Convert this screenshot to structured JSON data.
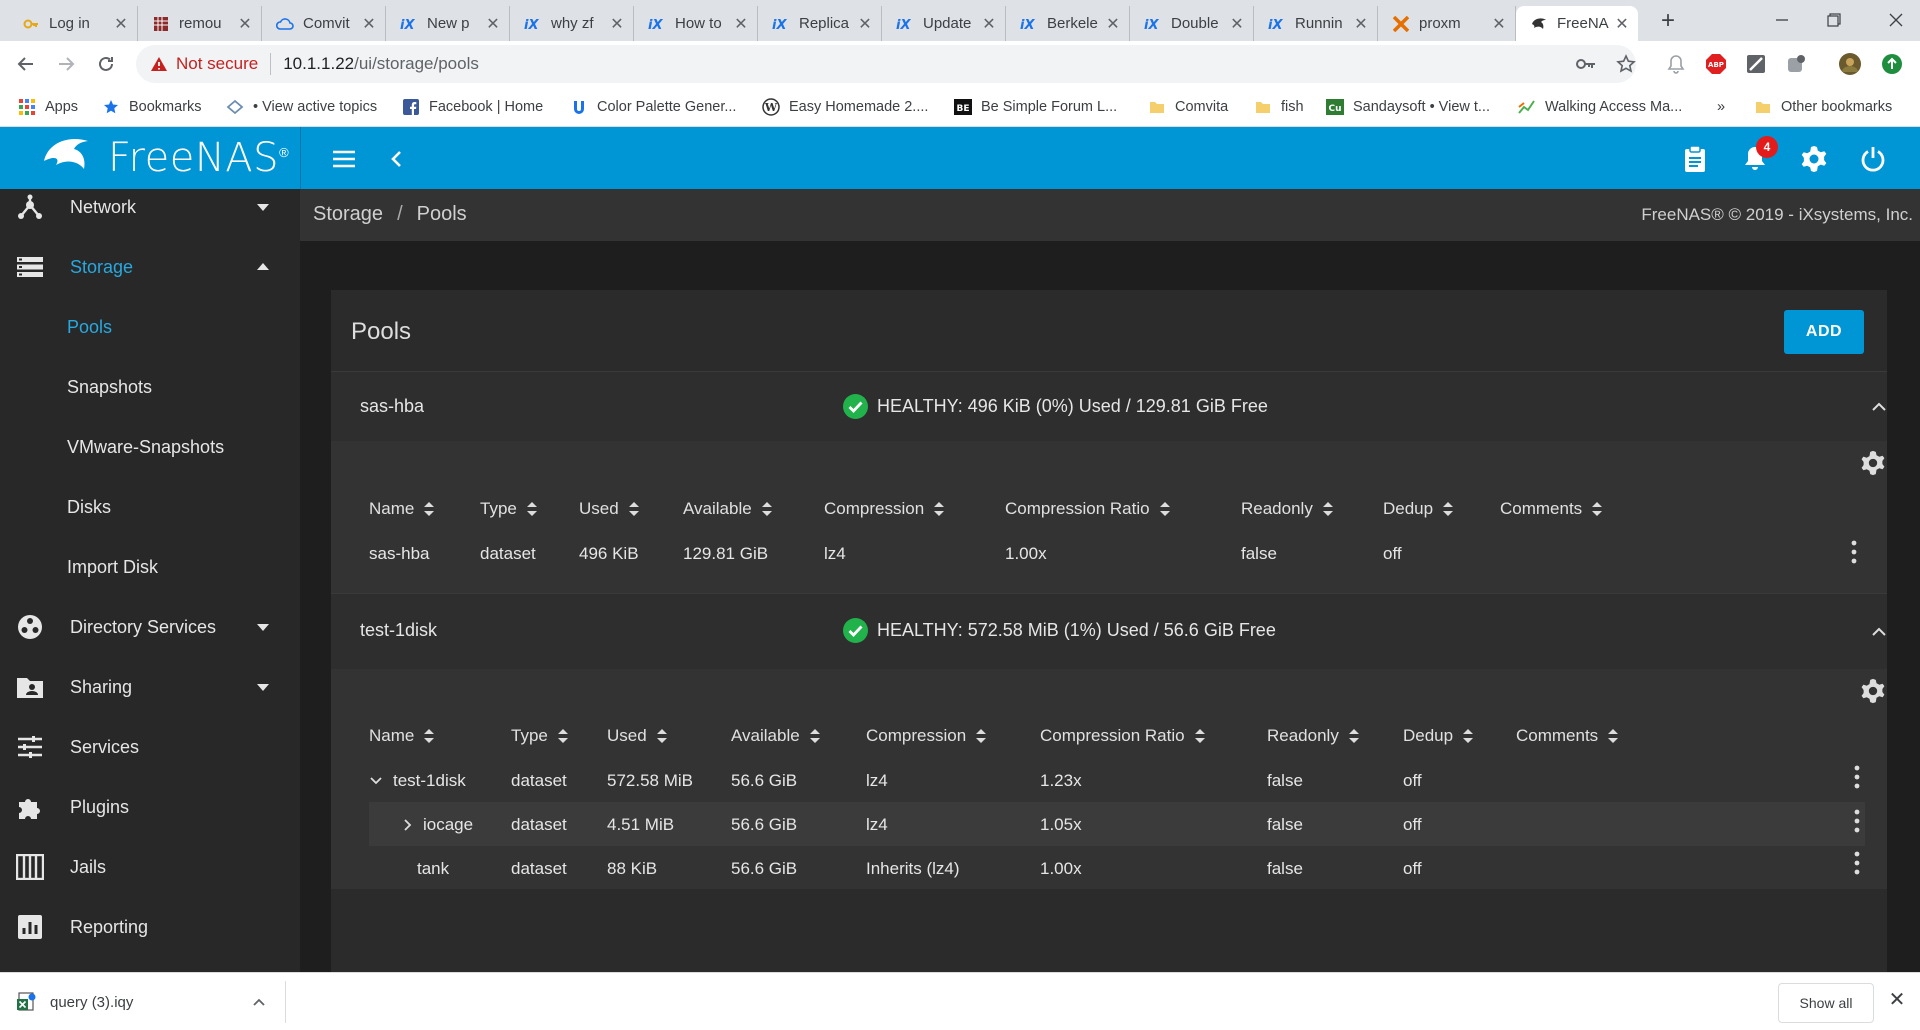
{
  "browser": {
    "tabs": [
      {
        "title": "Log in",
        "icon": "key-icon"
      },
      {
        "title": "remou",
        "icon": "grid-icon"
      },
      {
        "title": "Comvit",
        "icon": "cloud-icon"
      },
      {
        "title": "New p",
        "icon": "freenas-icon"
      },
      {
        "title": "why zf",
        "icon": "freenas-icon"
      },
      {
        "title": "How to",
        "icon": "freenas-icon"
      },
      {
        "title": "Replica",
        "icon": "freenas-icon"
      },
      {
        "title": "Update",
        "icon": "freenas-icon"
      },
      {
        "title": "Berkele",
        "icon": "freenas-icon"
      },
      {
        "title": "Double",
        "icon": "freenas-icon"
      },
      {
        "title": "Runnin",
        "icon": "freenas-icon"
      },
      {
        "title": "proxm",
        "icon": "proxmox-icon"
      },
      {
        "title": "FreeNA",
        "icon": "freenas-logo-icon",
        "active": true
      }
    ],
    "security_label": "Not secure",
    "url_host": "10.1.1.22",
    "url_path": "/ui/storage/pools",
    "bookmarks": [
      {
        "label": "Apps",
        "icon": "apps-grid-icon"
      },
      {
        "label": "Bookmarks",
        "icon": "star-icon"
      },
      {
        "label": "• View active topics",
        "icon": "forum-icon"
      },
      {
        "label": "Facebook | Home",
        "icon": "facebook-icon"
      },
      {
        "label": "Color Palette Gener...",
        "icon": "palette-icon"
      },
      {
        "label": "Easy Homemade 2....",
        "icon": "wordpress-icon"
      },
      {
        "label": "Be Simple Forum L...",
        "icon": "be-icon"
      },
      {
        "label": "Comvita",
        "icon": "folder-icon"
      },
      {
        "label": "fish",
        "icon": "folder-icon"
      },
      {
        "label": "Sandaysoft • View t...",
        "icon": "cu-icon"
      },
      {
        "label": "Walking Access Ma...",
        "icon": "walking-icon"
      }
    ],
    "bookmarks_overflow": "»",
    "other_bookmarks": "Other bookmarks",
    "ext_abp": "ABP"
  },
  "app": {
    "brand": "FreeNAS",
    "brand_tm": "®",
    "notification_count": "4",
    "breadcrumb": [
      "Storage",
      "Pools"
    ],
    "copyright": "FreeNAS® © 2019 - iXsystems, Inc.",
    "sidebar": {
      "network": "Network",
      "storage": "Storage",
      "storage_sub": [
        "Pools",
        "Snapshots",
        "VMware-Snapshots",
        "Disks",
        "Import Disk"
      ],
      "directory_services": "Directory Services",
      "sharing": "Sharing",
      "services": "Services",
      "plugins": "Plugins",
      "jails": "Jails",
      "reporting": "Reporting"
    },
    "card_title": "Pools",
    "add_label": "ADD",
    "columns": [
      "Name",
      "Type",
      "Used",
      "Available",
      "Compression",
      "Compression Ratio",
      "Readonly",
      "Dedup",
      "Comments"
    ],
    "pools": [
      {
        "name": "sas-hba",
        "status": "HEALTHY: 496 KiB (0%) Used / 129.81 GiB Free",
        "rows": [
          {
            "name": "sas-hba",
            "type": "dataset",
            "used": "496 KiB",
            "available": "129.81 GiB",
            "compression": "lz4",
            "ratio": "1.00x",
            "readonly": "false",
            "dedup": "off",
            "comments": ""
          }
        ]
      },
      {
        "name": "test-1disk",
        "status": "HEALTHY: 572.58 MiB (1%) Used / 56.6 GiB Free",
        "rows": [
          {
            "name": "test-1disk",
            "type": "dataset",
            "used": "572.58 MiB",
            "available": "56.6 GiB",
            "compression": "lz4",
            "ratio": "1.23x",
            "readonly": "false",
            "dedup": "off",
            "comments": ""
          },
          {
            "name": "iocage",
            "type": "dataset",
            "used": "4.51 MiB",
            "available": "56.6 GiB",
            "compression": "lz4",
            "ratio": "1.05x",
            "readonly": "false",
            "dedup": "off",
            "comments": ""
          },
          {
            "name": "tank",
            "type": "dataset",
            "used": "88 KiB",
            "available": "56.6 GiB",
            "compression": "Inherits (lz4)",
            "ratio": "1.00x",
            "readonly": "false",
            "dedup": "off",
            "comments": ""
          }
        ]
      }
    ]
  },
  "downloads": {
    "file": "query (3).iqy",
    "show_all": "Show all"
  },
  "colors": {
    "accent": "#0095d5",
    "sidebar_active": "#28a8e0",
    "healthy": "#21b24b",
    "badge": "#e31b1b"
  }
}
